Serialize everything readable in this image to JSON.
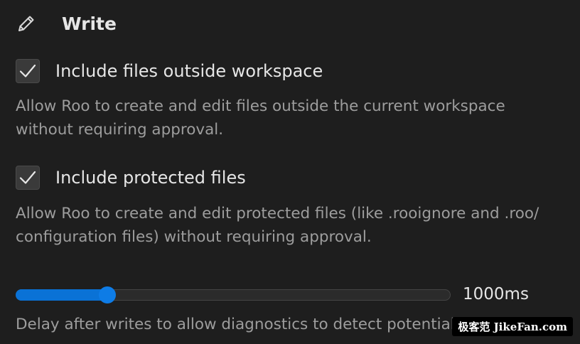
{
  "section": {
    "icon": "pencil-icon",
    "title": "Write"
  },
  "settings": [
    {
      "label": "Include files outside workspace",
      "checked": true,
      "description": "Allow Roo to create and edit files outside the current workspace without requiring approval."
    },
    {
      "label": "Include protected files",
      "checked": true,
      "description": "Allow Roo to create and edit protected files (like .rooignore and .roo/ configuration files) without requiring approval."
    }
  ],
  "delay": {
    "fraction": 0.21,
    "value_label": "1000ms",
    "description": "Delay after writes to allow diagnostics to detect potential problems"
  },
  "watermark": "极客范 JikeFan.com",
  "colors": {
    "accent": "#0e7ce6",
    "background": "#1e1e1e",
    "text": "#e6e6e6",
    "muted_text": "#9d9d9d"
  }
}
